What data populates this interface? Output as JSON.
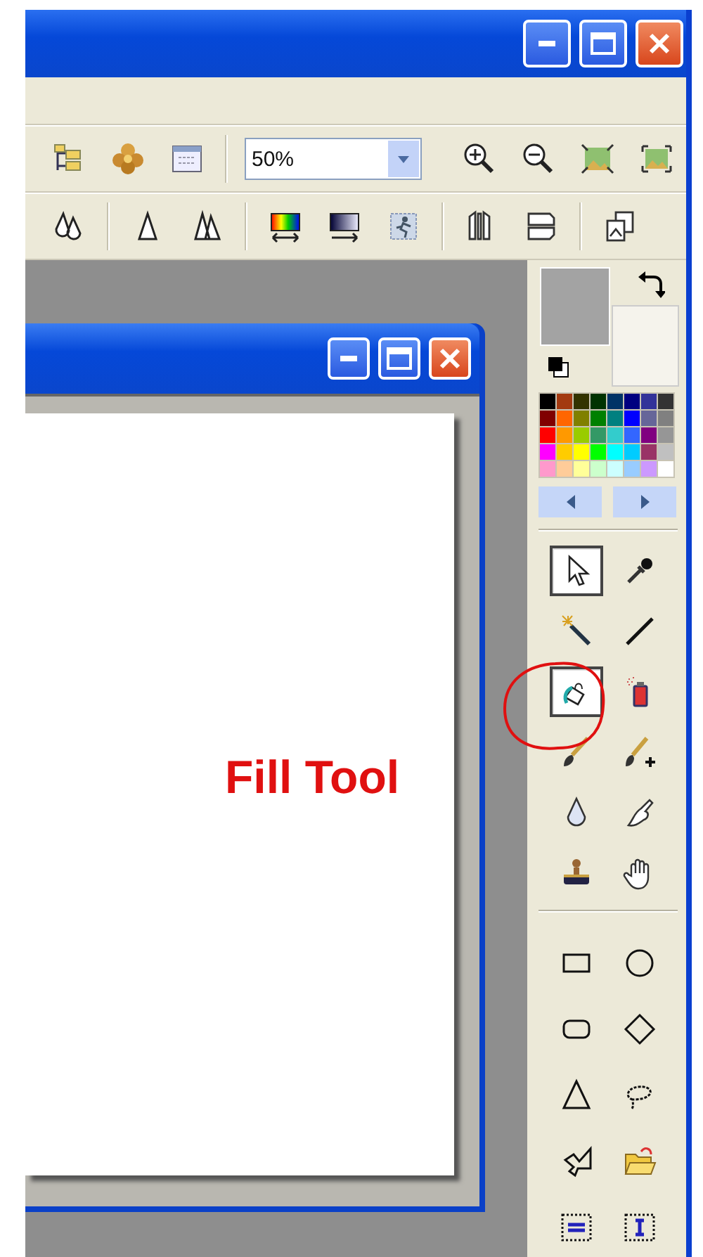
{
  "zoom_combo": {
    "value": "50%"
  },
  "colors": {
    "foreground": {
      "color": "#a3a3a3"
    },
    "background": {
      "color": "#f5f3ec"
    }
  },
  "palette": [
    {
      "color": "#000000"
    },
    {
      "color": "#a33a10"
    },
    {
      "color": "#333300"
    },
    {
      "color": "#003300"
    },
    {
      "color": "#003366"
    },
    {
      "color": "#000080"
    },
    {
      "color": "#333399"
    },
    {
      "color": "#333333"
    },
    {
      "color": "#800000"
    },
    {
      "color": "#ff6600"
    },
    {
      "color": "#808000"
    },
    {
      "color": "#008000"
    },
    {
      "color": "#008080"
    },
    {
      "color": "#0000ff"
    },
    {
      "color": "#666699"
    },
    {
      "color": "#808080"
    },
    {
      "color": "#ff0000"
    },
    {
      "color": "#ff9900"
    },
    {
      "color": "#99cc00"
    },
    {
      "color": "#339966"
    },
    {
      "color": "#33cccc"
    },
    {
      "color": "#3366ff"
    },
    {
      "color": "#800080"
    },
    {
      "color": "#969696"
    },
    {
      "color": "#ff00ff"
    },
    {
      "color": "#ffcc00"
    },
    {
      "color": "#ffff00"
    },
    {
      "color": "#00ff00"
    },
    {
      "color": "#00ffff"
    },
    {
      "color": "#00ccff"
    },
    {
      "color": "#993366"
    },
    {
      "color": "#c0c0c0"
    },
    {
      "color": "#ff99cc"
    },
    {
      "color": "#ffcc99"
    },
    {
      "color": "#ffff99"
    },
    {
      "color": "#ccffcc"
    },
    {
      "color": "#ccffff"
    },
    {
      "color": "#99ccff"
    },
    {
      "color": "#cc99ff"
    },
    {
      "color": "#ffffff"
    }
  ],
  "tools": [
    {
      "selected": true
    },
    {
      "selected": false
    },
    {
      "selected": false
    },
    {
      "selected": false
    },
    {
      "selected": true
    },
    {
      "selected": false
    },
    {
      "selected": false
    },
    {
      "selected": false
    },
    {
      "selected": false
    },
    {
      "selected": false
    },
    {
      "selected": false
    },
    {
      "selected": false
    }
  ],
  "shape_tools": [
    {
      "selected": false
    },
    {
      "selected": false
    },
    {
      "selected": false
    },
    {
      "selected": false
    },
    {
      "selected": false
    },
    {
      "selected": false
    },
    {
      "selected": false
    },
    {
      "selected": false
    },
    {
      "selected": false
    },
    {
      "selected": false
    }
  ],
  "annotation": {
    "text": "Fill Tool"
  }
}
